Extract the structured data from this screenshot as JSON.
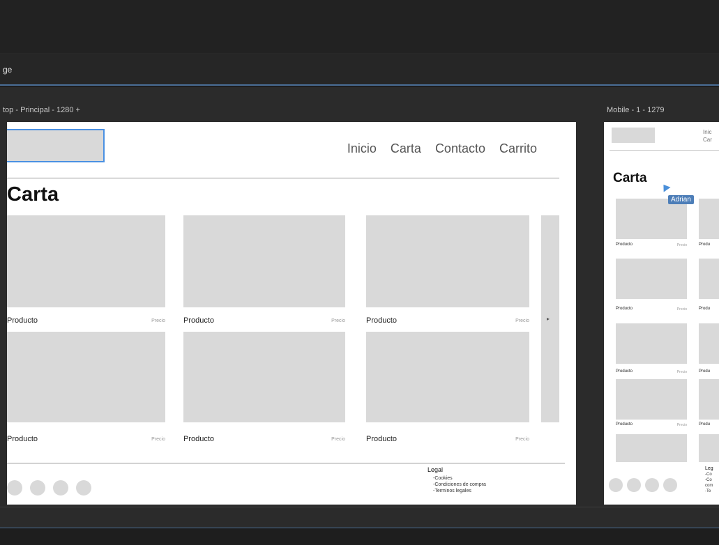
{
  "page": {
    "label": "ge"
  },
  "desktop": {
    "title": "top - Principal - 1280 +",
    "nav": [
      "Inicio",
      "Carta",
      "Contacto",
      "Carrito"
    ],
    "heading": "Carta",
    "products": [
      {
        "name": "Producto",
        "price": "Precio"
      },
      {
        "name": "Producto",
        "price": "Precio"
      },
      {
        "name": "Producto",
        "price": "Precio"
      },
      {
        "name": "Producto",
        "price": "Precio"
      },
      {
        "name": "Producto",
        "price": "Precio"
      },
      {
        "name": "Producto",
        "price": "Precio"
      }
    ],
    "scroll_arrow": "▸",
    "legal": {
      "title": "Legal",
      "items": [
        "-Cookies",
        "-Condiciones de compra",
        "-Terminos legales"
      ]
    }
  },
  "mobile": {
    "title": "Mobile - 1 - 1279",
    "nav": [
      "Inic",
      "Car"
    ],
    "heading": "Carta",
    "products": [
      {
        "name": "Producto",
        "price": "Precio",
        "name2": "Produ"
      },
      {
        "name": "Producto",
        "price": "Precio",
        "name2": "Produ"
      },
      {
        "name": "Producto",
        "price": "Precio",
        "name2": "Produ"
      },
      {
        "name": "Producto",
        "price": "Precio",
        "name2": "Produ"
      }
    ],
    "legal": {
      "title": "Leg",
      "items": [
        "-Co",
        "-Co",
        "com",
        "-Te"
      ]
    }
  },
  "collaborator": {
    "name": "Adrian",
    "color": "#4d7eb8"
  },
  "colors": {
    "accent": "#4a90e2",
    "placeholder": "#d9d9d9",
    "chrome": "#1e1e1e"
  },
  "icons": {
    "social": "circle-placeholder-icon",
    "cursor": "collaborator-cursor-icon"
  }
}
